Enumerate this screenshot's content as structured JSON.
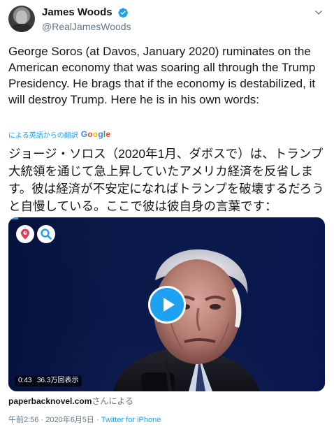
{
  "author": {
    "display_name": "James Woods",
    "handle": "@RealJamesWoods",
    "verified": true
  },
  "tweet": {
    "text": "George Soros (at Davos, January 2020) ruminates on the American economy that was soaring all through the Trump Presidency. He brags that if the economy is destabilized, it will destroy Trump. Here he is in his own words:",
    "translate_label": "による英語からの翻訳",
    "translate_provider": "Google",
    "translated_text": "ジョージ・ソロス（2020年1月、ダボスで）は、トランプ大統領を通じて急上昇していたアメリカ経済を反省します。彼は経済が不安定になればトランプを破壊するだろうと自慢している。ここで彼は彼自身の言葉です："
  },
  "video": {
    "duration": "0:43",
    "views": "36.3万回表示",
    "icons": [
      "periscope-icon",
      "magnify-icon",
      "play-icon"
    ]
  },
  "attribution": {
    "domain": "paperbacknovel.com",
    "suffix": "さんによる"
  },
  "meta": {
    "time": "午前2:56",
    "separator1": "·",
    "date": "2020年6月5日",
    "separator2": "·",
    "source": "Twitter for iPhone"
  },
  "colors": {
    "accent": "#1da1f2",
    "secondary_text": "#657786",
    "primary_text": "#14171a"
  }
}
